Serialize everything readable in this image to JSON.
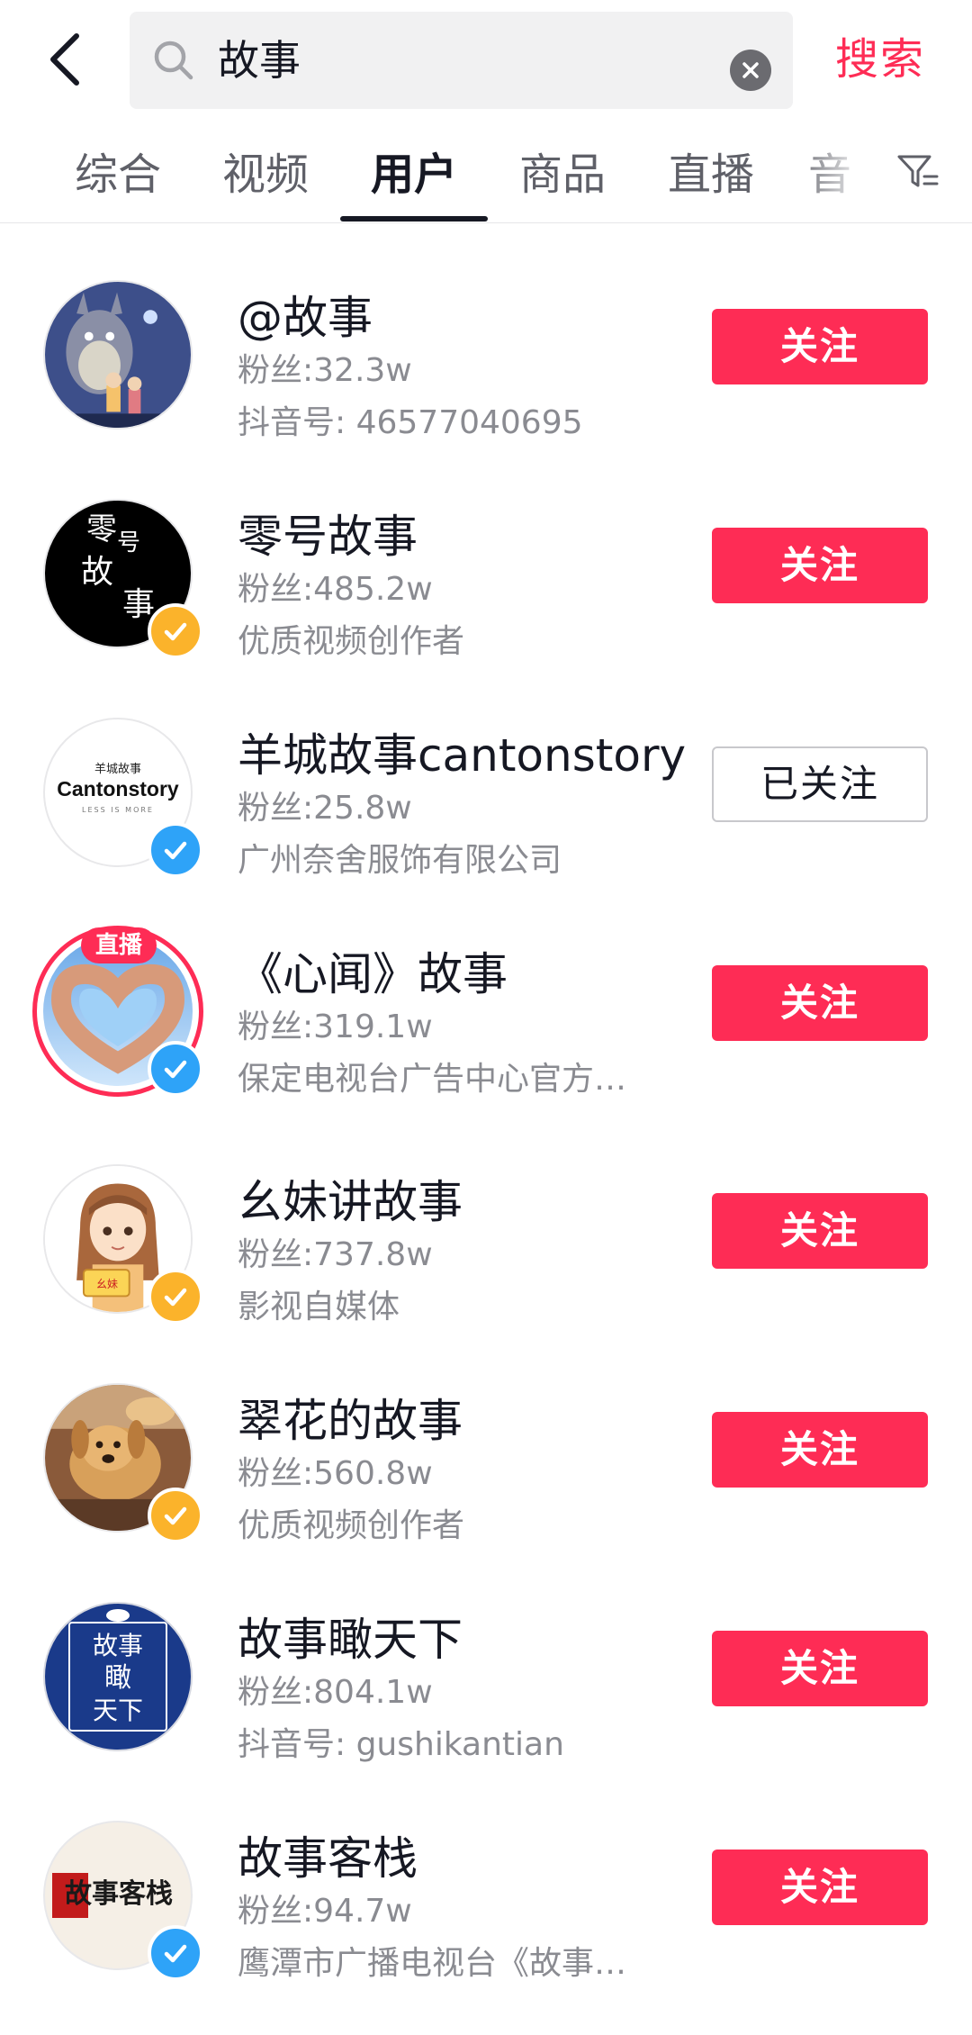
{
  "header": {
    "search_query": "故事",
    "search_button": "搜索"
  },
  "tabs": [
    {
      "label": "综合"
    },
    {
      "label": "视频"
    },
    {
      "label": "用户"
    },
    {
      "label": "商品"
    },
    {
      "label": "直播"
    },
    {
      "label": "音"
    }
  ],
  "users": [
    {
      "name": "@故事",
      "fans": "粉丝:32.3w",
      "desc": "抖音号: 46577040695",
      "button": "关注",
      "verified": "none",
      "live": false,
      "live_label": ""
    },
    {
      "name": "零号故事",
      "fans": "粉丝:485.2w",
      "desc": "优质视频创作者",
      "button": "关注",
      "verified": "yellow",
      "live": false,
      "live_label": ""
    },
    {
      "name": "羊城故事cantonstory",
      "fans": "粉丝:25.8w",
      "desc": "广州奈舍服饰有限公司",
      "button": "已关注",
      "verified": "blue",
      "live": false,
      "live_label": ""
    },
    {
      "name": "《心闻》故事",
      "fans": "粉丝:319.1w",
      "desc": "保定电视台广告中心官方…",
      "button": "关注",
      "verified": "blue",
      "live": true,
      "live_label": "直播"
    },
    {
      "name": "幺妹讲故事",
      "fans": "粉丝:737.8w",
      "desc": "影视自媒体",
      "button": "关注",
      "verified": "yellow",
      "live": false,
      "live_label": ""
    },
    {
      "name": "翠花的故事",
      "fans": "粉丝:560.8w",
      "desc": "优质视频创作者",
      "button": "关注",
      "verified": "yellow",
      "live": false,
      "live_label": ""
    },
    {
      "name": "故事瞰天下",
      "fans": "粉丝:804.1w",
      "desc": "抖音号: gushikantian",
      "button": "关注",
      "verified": "none",
      "live": false,
      "live_label": ""
    },
    {
      "name": "故事客栈",
      "fans": "粉丝:94.7w",
      "desc": "鹰潭市广播电视台《故事…",
      "button": "关注",
      "verified": "blue",
      "live": false,
      "live_label": ""
    }
  ],
  "avatar_text": {
    "zero": [
      "零",
      "号",
      "故",
      "事"
    ],
    "canton_top": "羊城故事",
    "canton_main": "Cantonstory",
    "canton_sub": "LESS IS MORE",
    "kan": [
      "故事",
      "瞰",
      "天下"
    ],
    "kezhan": "故事客栈",
    "yaomei": "幺妹"
  },
  "colors": {
    "accent": "#fe2c55",
    "verify_yellow": "#fbb32b",
    "verify_blue": "#2ea3f8",
    "text_primary": "#161823",
    "text_secondary": "#8a8b91"
  },
  "icons": {
    "back": "chevron-left-icon",
    "search": "search-icon",
    "clear": "clear-icon",
    "filter": "filter-icon",
    "verified": "check-icon"
  }
}
